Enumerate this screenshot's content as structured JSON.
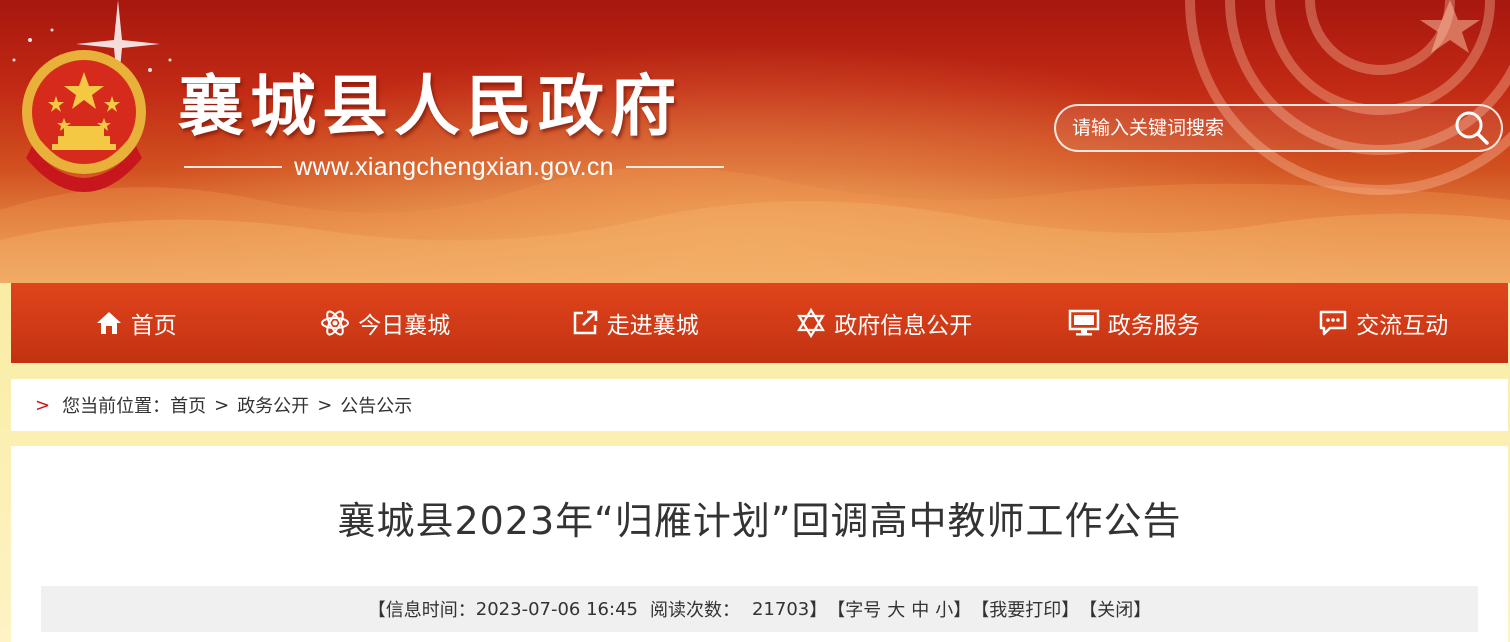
{
  "header": {
    "site_title": "襄城县人民政府",
    "site_url": "www.xiangchengxian.gov.cn",
    "search_placeholder": "请输入关键词搜索"
  },
  "nav": {
    "items": [
      {
        "label": "首页",
        "icon": "home-icon"
      },
      {
        "label": "今日襄城",
        "icon": "atom-icon"
      },
      {
        "label": "走进襄城",
        "icon": "external-link-icon"
      },
      {
        "label": "政府信息公开",
        "icon": "star-of-david-icon"
      },
      {
        "label": "政务服务",
        "icon": "monitor-icon"
      },
      {
        "label": "交流互动",
        "icon": "chat-icon"
      }
    ]
  },
  "breadcrumb": {
    "arrow": ">",
    "prefix": "您当前位置：",
    "items": [
      "首页",
      "政务公开",
      "公告公示"
    ],
    "separator": ">"
  },
  "article": {
    "title": "襄城县2023年“归雁计划”回调高中教师工作公告",
    "meta": {
      "time_label": "【信息时间：",
      "time_value": "2023-07-06 16:45",
      "views_label": "阅读次数：",
      "views_value": "21703",
      "views_close": "】",
      "font_label": "【字号",
      "font_large": "大",
      "font_medium": "中",
      "font_small": "小",
      "font_close": "】",
      "print": "【我要打印】",
      "close": "【关闭】"
    }
  },
  "colors": {
    "header_dark_red": "#a7170f",
    "nav_red": "#d03a17",
    "breadcrumb_arrow": "#c8161d",
    "page_yellow": "#f5e58a",
    "text": "#333333"
  }
}
